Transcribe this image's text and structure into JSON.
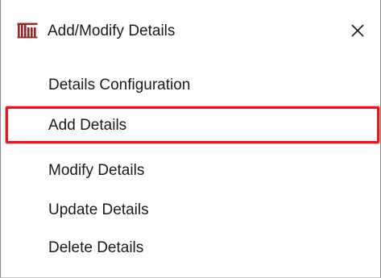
{
  "header": {
    "title": "Add/Modify Details",
    "icon": "columns-icon",
    "close_label": "✕"
  },
  "menu": {
    "items": [
      {
        "label": "Details Configuration"
      },
      {
        "label": "Add Details",
        "selected": true
      },
      {
        "label": "Modify Details"
      },
      {
        "label": "Update Details"
      },
      {
        "label": "Delete Details"
      }
    ]
  },
  "colors": {
    "highlight_border": "#e8141e",
    "icon_color": "#8b2a2a"
  }
}
